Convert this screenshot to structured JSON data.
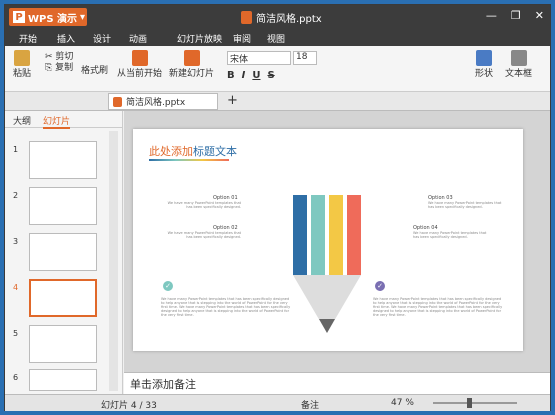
{
  "app": {
    "name": "WPS 演示",
    "doc_title": "简洁风格.pptx"
  },
  "menu": [
    "开始",
    "插入",
    "设计",
    "动画",
    "幻灯片放映",
    "审阅",
    "视图"
  ],
  "ribbon": {
    "paste": "粘贴",
    "cut": "剪切",
    "copy": "复制",
    "format_painter": "格式刷",
    "from_current": "从当前开始",
    "new_slide": "新建幻灯片",
    "font_name": "宋体",
    "font_size": "18",
    "shape": "形状",
    "textbox": "文本框"
  },
  "tab": {
    "name": "简洁风格.pptx",
    "add": "+"
  },
  "panel": {
    "outline": "大纲",
    "slides": "幻灯片"
  },
  "thumbs": [
    "1",
    "2",
    "3",
    "4",
    "5",
    "6"
  ],
  "slide": {
    "title_a": "此处添加",
    "title_b": "标题文本",
    "options": [
      {
        "label": "Option 01",
        "text": "We have many PowerPoint templates that has been specifically designed."
      },
      {
        "label": "Option 02",
        "text": "We have many PowerPoint templates that has been specifically designed."
      },
      {
        "label": "Option 03",
        "text": "We have many PowerPoint templates that has been specifically designed."
      },
      {
        "label": "Option 04",
        "text": "We have many PowerPoint templates that has been specifically designed."
      }
    ],
    "para_left": "We have many PowerPoint templates that has been specifically designed to help anyone that is stepping into the world of PowerPoint for the very first time. We have many PowerPoint templates that has been specifically designed to help anyone that is stepping into the world of PowerPoint for the very first time.",
    "para_right": "We have many PowerPoint templates that has been specifically designed to help anyone that is stepping into the world of PowerPoint for the very first time. We have many PowerPoint templates that has been specifically designed to help anyone that is stepping into the world of PowerPoint for the very first time."
  },
  "notes_placeholder": "单击添加备注",
  "status": {
    "slide_counter": "幻灯片 4 / 33",
    "notes": "备注",
    "zoom": "47 %"
  },
  "colors": {
    "blue": "#2e6ea6",
    "teal": "#7ec8c0",
    "yellow": "#f3c845",
    "red": "#ef6b5a",
    "accent": "#e0682a"
  }
}
